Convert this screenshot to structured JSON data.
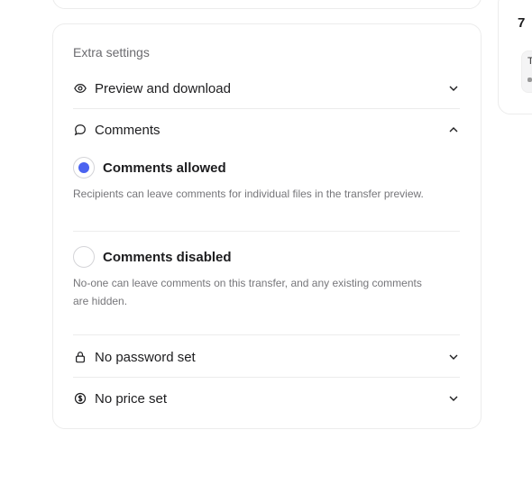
{
  "background_cards": {
    "right_number": "7",
    "right_chip_letter": "T"
  },
  "extra_settings": {
    "title": "Extra settings",
    "preview": {
      "label": "Preview and download",
      "icon": "eye-icon",
      "expanded": false
    },
    "comments": {
      "label": "Comments",
      "icon": "speech-bubble-icon",
      "expanded": true,
      "options": [
        {
          "label": "Comments allowed",
          "description": "Recipients can leave comments for individual files in the transfer preview.",
          "selected": true
        },
        {
          "label": "Comments disabled",
          "description": "No-one can leave comments on this transfer, and any existing comments are hidden.",
          "selected": false
        }
      ]
    },
    "password": {
      "label": "No password set",
      "icon": "lock-icon",
      "expanded": false
    },
    "price": {
      "label": "No price set",
      "icon": "dollar-coin-icon",
      "expanded": false
    }
  },
  "colors": {
    "accent": "#4b63f0",
    "border": "#ececec",
    "muted_text": "#76767a"
  }
}
